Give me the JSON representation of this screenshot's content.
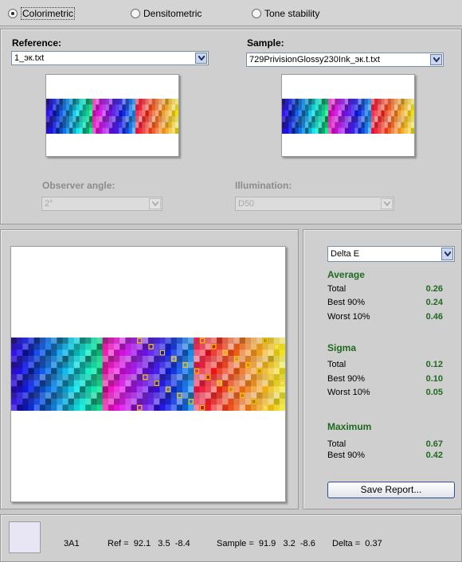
{
  "mode_radios": [
    {
      "label": "Colorimetric",
      "selected": true
    },
    {
      "label": "Densitometric",
      "selected": false
    },
    {
      "label": "Tone stability",
      "selected": false
    }
  ],
  "reference": {
    "label": "Reference:",
    "file": "1_эк.txt"
  },
  "sample": {
    "label": "Sample:",
    "file": "729PrivisionGlossy230Ink_эк.t.txt"
  },
  "observer": {
    "label": "Observer angle:",
    "value": "2°"
  },
  "illumination": {
    "label": "Illumination:",
    "value": "D50"
  },
  "metric_select": {
    "value": "Delta E"
  },
  "stats": {
    "average": {
      "title": "Average",
      "rows": [
        {
          "label": "Total",
          "value": "0.26"
        },
        {
          "label": "Best 90%",
          "value": "0.24"
        },
        {
          "label": "Worst 10%",
          "value": "0.46"
        }
      ]
    },
    "sigma": {
      "title": "Sigma",
      "rows": [
        {
          "label": "Total",
          "value": "0.12"
        },
        {
          "label": "Best 90%",
          "value": "0.10"
        },
        {
          "label": "Worst 10%",
          "value": "0.05"
        }
      ]
    },
    "maximum": {
      "title": "Maximum",
      "rows": [
        {
          "label": "Total",
          "value": "0.67"
        },
        {
          "label": "Best 90%",
          "value": "0.42"
        }
      ]
    }
  },
  "save_button": "Save Report...",
  "patch_info": {
    "id": "3A1",
    "ref": "Ref =  92.1   3.5  -8.4",
    "sample": "Sample =  91.9   3.2  -8.6",
    "delta": "Delta =  0.37"
  },
  "colors": {
    "swatch": "#e8e6f4",
    "stat_green": "#1f6a1f"
  }
}
